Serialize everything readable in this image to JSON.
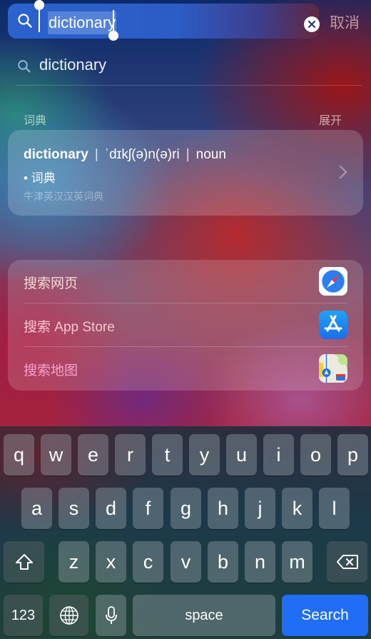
{
  "search": {
    "query": "dictionary",
    "clear_icon": "clear-x-icon",
    "cancel_label": "取消"
  },
  "suggestion": {
    "icon": "search-icon",
    "text": "dictionary"
  },
  "dictionary_section": {
    "title": "词典",
    "expand_label": "展开",
    "entry": {
      "word": "dictionary",
      "separator": "|",
      "pronunciation": "ˈdɪkʃ(ə)n(ə)ri",
      "part_of_speech": "noun",
      "definition": "• 词典",
      "source": "牛津英汉汉英词典"
    }
  },
  "actions": [
    {
      "label": "搜索网页",
      "icon": "safari-icon",
      "color": "#f3dcd0"
    },
    {
      "label": "搜索 App Store",
      "icon": "app-store-icon",
      "color": "#f4c8cf"
    },
    {
      "label": "搜索地图",
      "icon": "maps-icon",
      "color": "#f6a3d2"
    }
  ],
  "keyboard": {
    "row1": [
      "q",
      "w",
      "e",
      "r",
      "t",
      "y",
      "u",
      "i",
      "o",
      "p"
    ],
    "row2": [
      "a",
      "s",
      "d",
      "f",
      "g",
      "h",
      "j",
      "k",
      "l"
    ],
    "row3": [
      "z",
      "x",
      "c",
      "v",
      "b",
      "n",
      "m"
    ],
    "numbers_label": "123",
    "space_label": "space",
    "search_label": "Search",
    "search_color": "#1f6ef5"
  }
}
